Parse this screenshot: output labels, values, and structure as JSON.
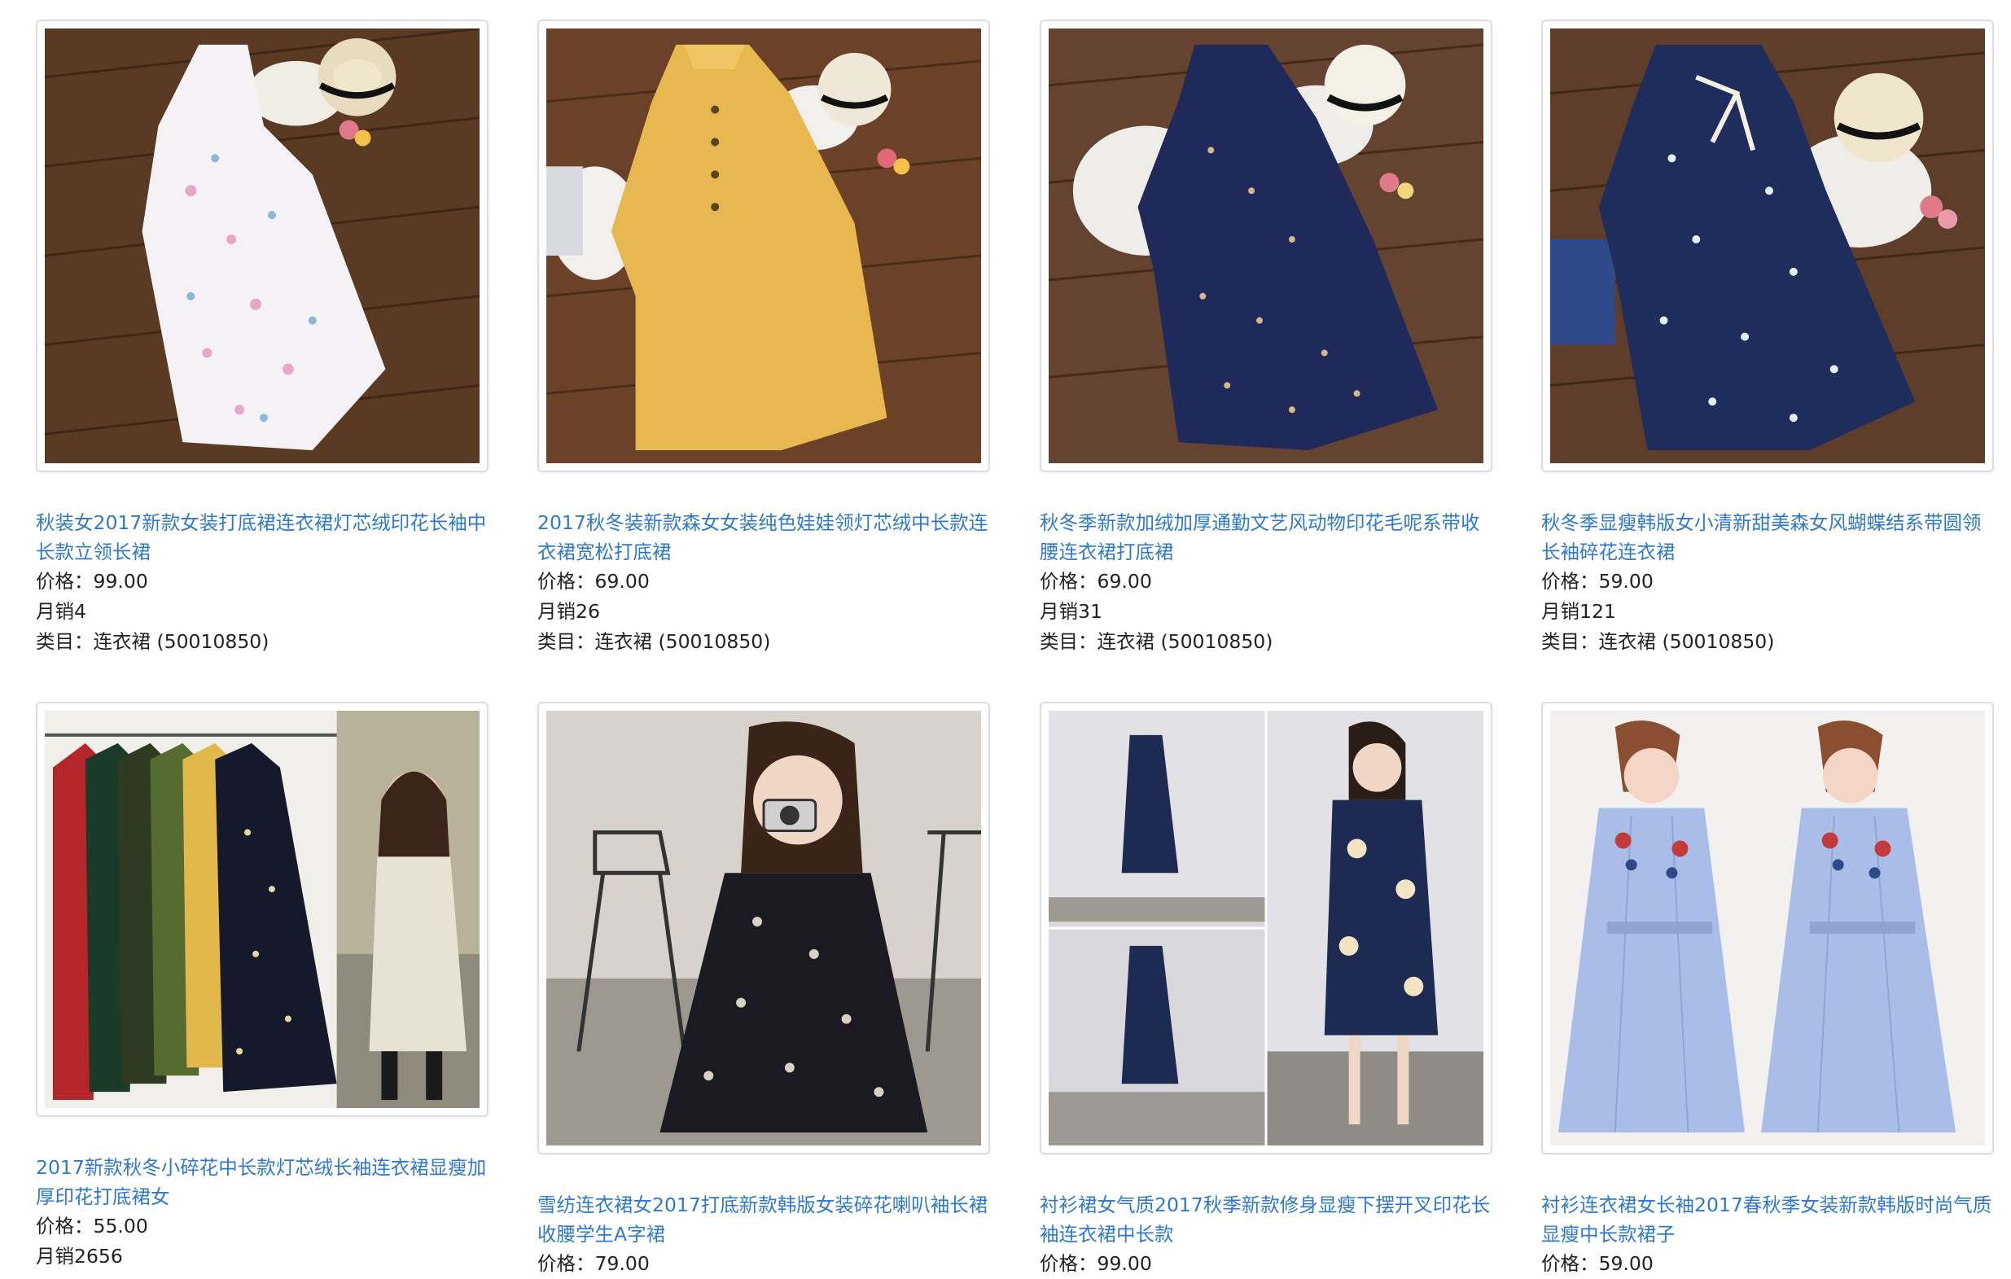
{
  "colors": {
    "link": "#2f7ac8",
    "text": "#222222",
    "border": "#dddddd"
  },
  "products": [
    {
      "title": "秋装女2017新款女装打底裙连衣裙灯芯绒印花长袖中长款立领长裙",
      "price": "价格：99.00",
      "sales": "月销4",
      "category": "类目：连衣裙 (50010850)",
      "image": "white-floral-dress-photo"
    },
    {
      "title": "2017秋冬装新款森女女装纯色娃娃领灯芯绒中长款连衣裙宽松打底裙",
      "price": "价格：69.00",
      "sales": "月销26",
      "category": "类目：连衣裙 (50010850)",
      "image": "yellow-corduroy-dress-photo"
    },
    {
      "title": "秋冬季新款加绒加厚通勤文艺风动物印花毛呢系带收腰连衣裙打底裙",
      "price": "价格：69.00",
      "sales": "月销31",
      "category": "类目：连衣裙 (50010850)",
      "image": "navy-animal-print-dress-photo"
    },
    {
      "title": "秋冬季显瘦韩版女小清新甜美森女风蝴蝶结系带圆领长袖碎花连衣裙",
      "price": "价格：59.00",
      "sales": "月销121",
      "category": "类目：连衣裙 (50010850)",
      "image": "navy-floral-bow-dress-photo"
    },
    {
      "title": "2017新款秋冬小碎花中长款灯芯绒长袖连衣裙显瘦加厚印花打底裙女",
      "price": "价格：55.00",
      "sales": "月销2656",
      "category": "",
      "image": "multicolor-floral-dresses-rack-photo"
    },
    {
      "title": "雪纺连衣裙女2017打底新款韩版女装碎花喇叭袖长裙收腰学生A字裙",
      "price": "价格：79.00",
      "sales": "",
      "category": "",
      "image": "chiffon-floral-dress-model-photo"
    },
    {
      "title": "衬衫裙女气质2017秋季新款修身显瘦下摆开叉印花长袖连衣裙中长款",
      "price": "价格：99.00",
      "sales": "",
      "category": "",
      "image": "navy-shirt-dress-model-photo"
    },
    {
      "title": "衬衫连衣裙女长袖2017春秋季女装新款韩版时尚气质显瘦中长款裙子",
      "price": "价格：59.00",
      "sales": "",
      "category": "",
      "image": "blue-embroidered-shirt-dress-photo"
    }
  ]
}
